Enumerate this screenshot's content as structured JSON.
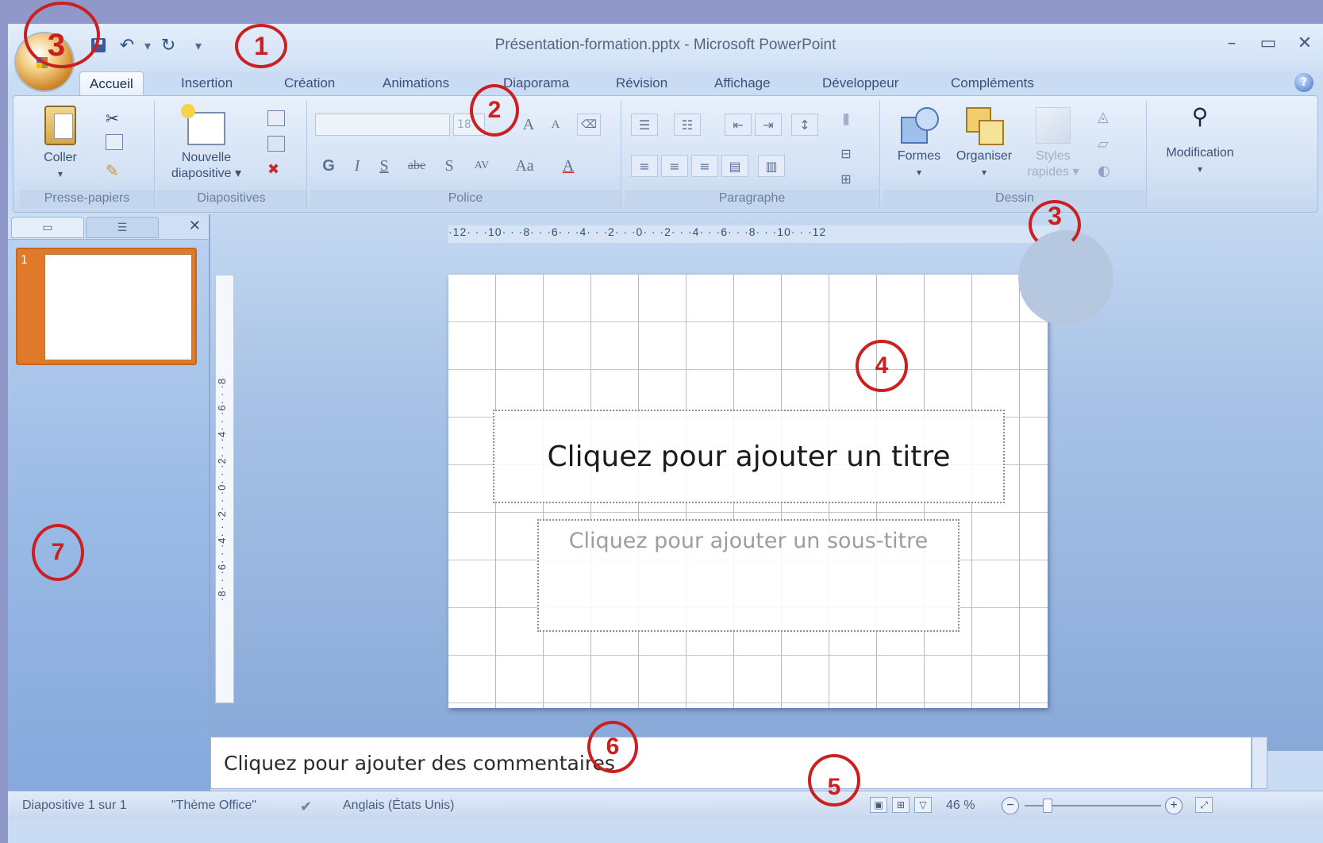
{
  "window": {
    "title": "Présentation-formation.pptx - Microsoft PowerPoint",
    "controls": [
      "–",
      "▭",
      "✕"
    ]
  },
  "quick_access": {
    "undo": "↶",
    "redo": "↻",
    "more": "▾"
  },
  "tabs": [
    "Accueil",
    "Insertion",
    "Création",
    "Animations",
    "Diaporama",
    "Révision",
    "Affichage",
    "Développeur",
    "Compléments"
  ],
  "ribbon": {
    "presse_papiers": {
      "label": "Presse-papiers",
      "paste": "Coller"
    },
    "diapositives": {
      "label": "Diapositives",
      "new_slide_line1": "Nouvelle",
      "new_slide_line2": "diapositive ▾"
    },
    "police": {
      "label": "Police",
      "size": "18",
      "grow": "A",
      "shrink": "A",
      "bold": "G",
      "italic": "I",
      "underline": "S",
      "strike": "abe",
      "shadow": "S",
      "spacing": "AV",
      "case": "Aa",
      "color": "A"
    },
    "paragraphe": {
      "label": "Paragraphe"
    },
    "dessin": {
      "label": "Dessin",
      "formes": "Formes",
      "organiser": "Organiser",
      "styles_line1": "Styles",
      "styles_line2": "rapides ▾"
    },
    "modification": {
      "label": "Modification"
    }
  },
  "ruler": {
    "horizontal": "·12· · ·10· · ·8· · ·6· · ·4· · ·2· · ·0· · ·2· · ·4· · ·6· · ·8· · ·10· · ·12",
    "vertical": "·8· · ·6· · ·4· · ·2· · ·0· · ·2· · ·4· · ·6· · ·8"
  },
  "slide_panel": {
    "slide_number": "1"
  },
  "slide": {
    "title_placeholder": "Cliquez pour ajouter un titre",
    "subtitle_placeholder": "Cliquez pour ajouter un sous-titre"
  },
  "notes": {
    "placeholder": "Cliquez pour ajouter des commentaires"
  },
  "status": {
    "slide_info": "Diapositive 1 sur 1",
    "theme": "\"Thème Office\"",
    "language": "Anglais (États Unis)",
    "zoom": "46 %"
  },
  "annotations": [
    "1",
    "2",
    "3",
    "3",
    "4",
    "5",
    "6",
    "7"
  ]
}
